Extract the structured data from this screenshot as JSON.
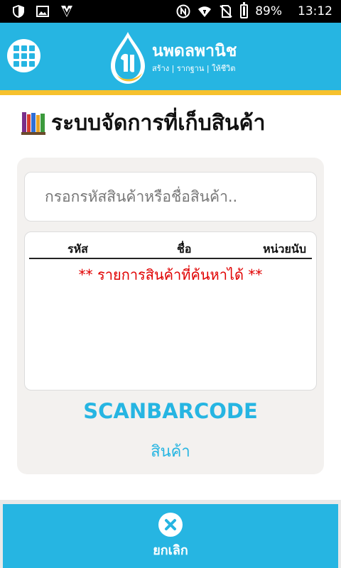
{
  "status_bar": {
    "left_icons": [
      "shield-icon",
      "image-icon",
      "app-check-icon"
    ],
    "right_icons": [
      "nfc-icon",
      "wifi-icon",
      "no-sim-icon",
      "battery-icon"
    ],
    "battery": "89%",
    "time": "13:12"
  },
  "header": {
    "brand_name": "นพดลพานิช",
    "slogan": "สร้าง | รากฐาน | ให้ชีวิต",
    "colors": {
      "primary": "#26b5e2",
      "accent": "#f6c12d"
    }
  },
  "page": {
    "title": "ระบบจัดการที่เก็บสินค้า"
  },
  "search": {
    "value": "",
    "placeholder": "กรอกรหัสสินค้าหรือชื่อสินค้า.."
  },
  "results": {
    "columns": [
      "รหัส",
      "ชื่อ",
      "หน่วยนับ"
    ],
    "empty_message": "** รายการสินค้าที่ค้นหาได้ **"
  },
  "scan": {
    "title": "SCANBARCODE",
    "subtitle": "สินค้า"
  },
  "footer": {
    "cancel_label": "ยกเลิก"
  }
}
